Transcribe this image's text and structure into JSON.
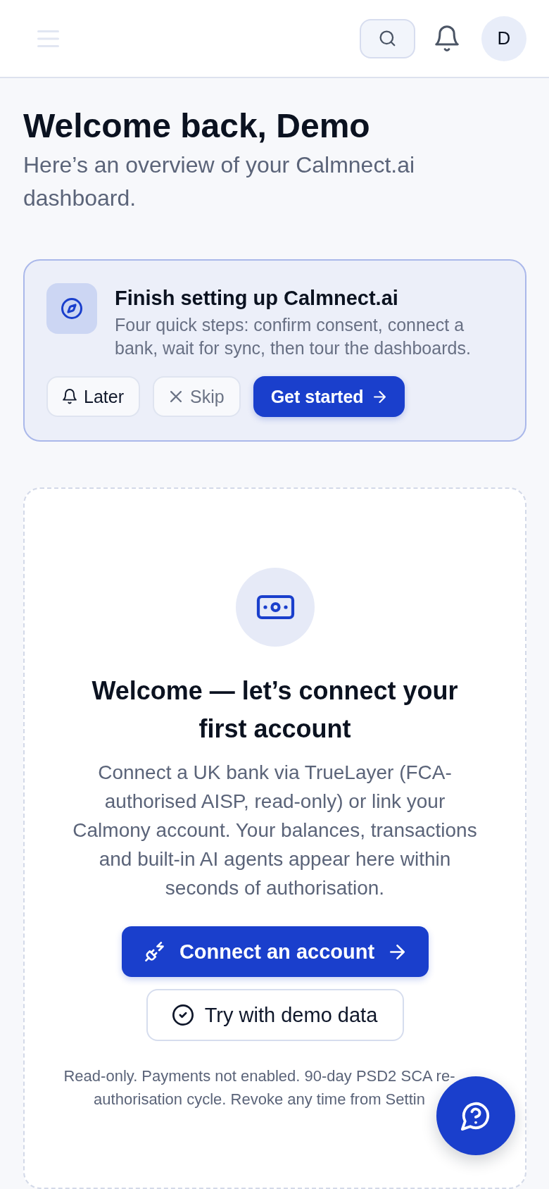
{
  "header": {
    "avatar_initial": "D"
  },
  "greeting": {
    "title": "Welcome back, Demo",
    "subtitle": "Here’s an overview of your Calmnect.ai dashboard."
  },
  "setup_card": {
    "title": "Finish setting up Calmnect.ai",
    "description": "Four quick steps: confirm consent, connect a bank, wait for sync, then tour the dashboards.",
    "actions": [
      {
        "label": "Later",
        "kind": "snooze"
      },
      {
        "label": "Skip",
        "kind": "dismiss"
      },
      {
        "label": "Get started",
        "kind": "primary"
      }
    ]
  },
  "empty_state": {
    "title": "Welcome — let’s connect your first account",
    "description": "Connect a UK bank via TrueLayer (FCA-authorised AISP, read-only) or link your Calmony account. Your balances, transactions and built-in AI agents appear here within seconds of authorisation.",
    "actions": [
      {
        "label": "Connect an account",
        "kind": "primary"
      },
      {
        "label": "Try with demo data",
        "kind": "secondary"
      }
    ],
    "footnote": "Read-only. Payments not enabled. 90-day PSD2 SCA re-authorisation cycle. Revoke any time from Settin"
  }
}
